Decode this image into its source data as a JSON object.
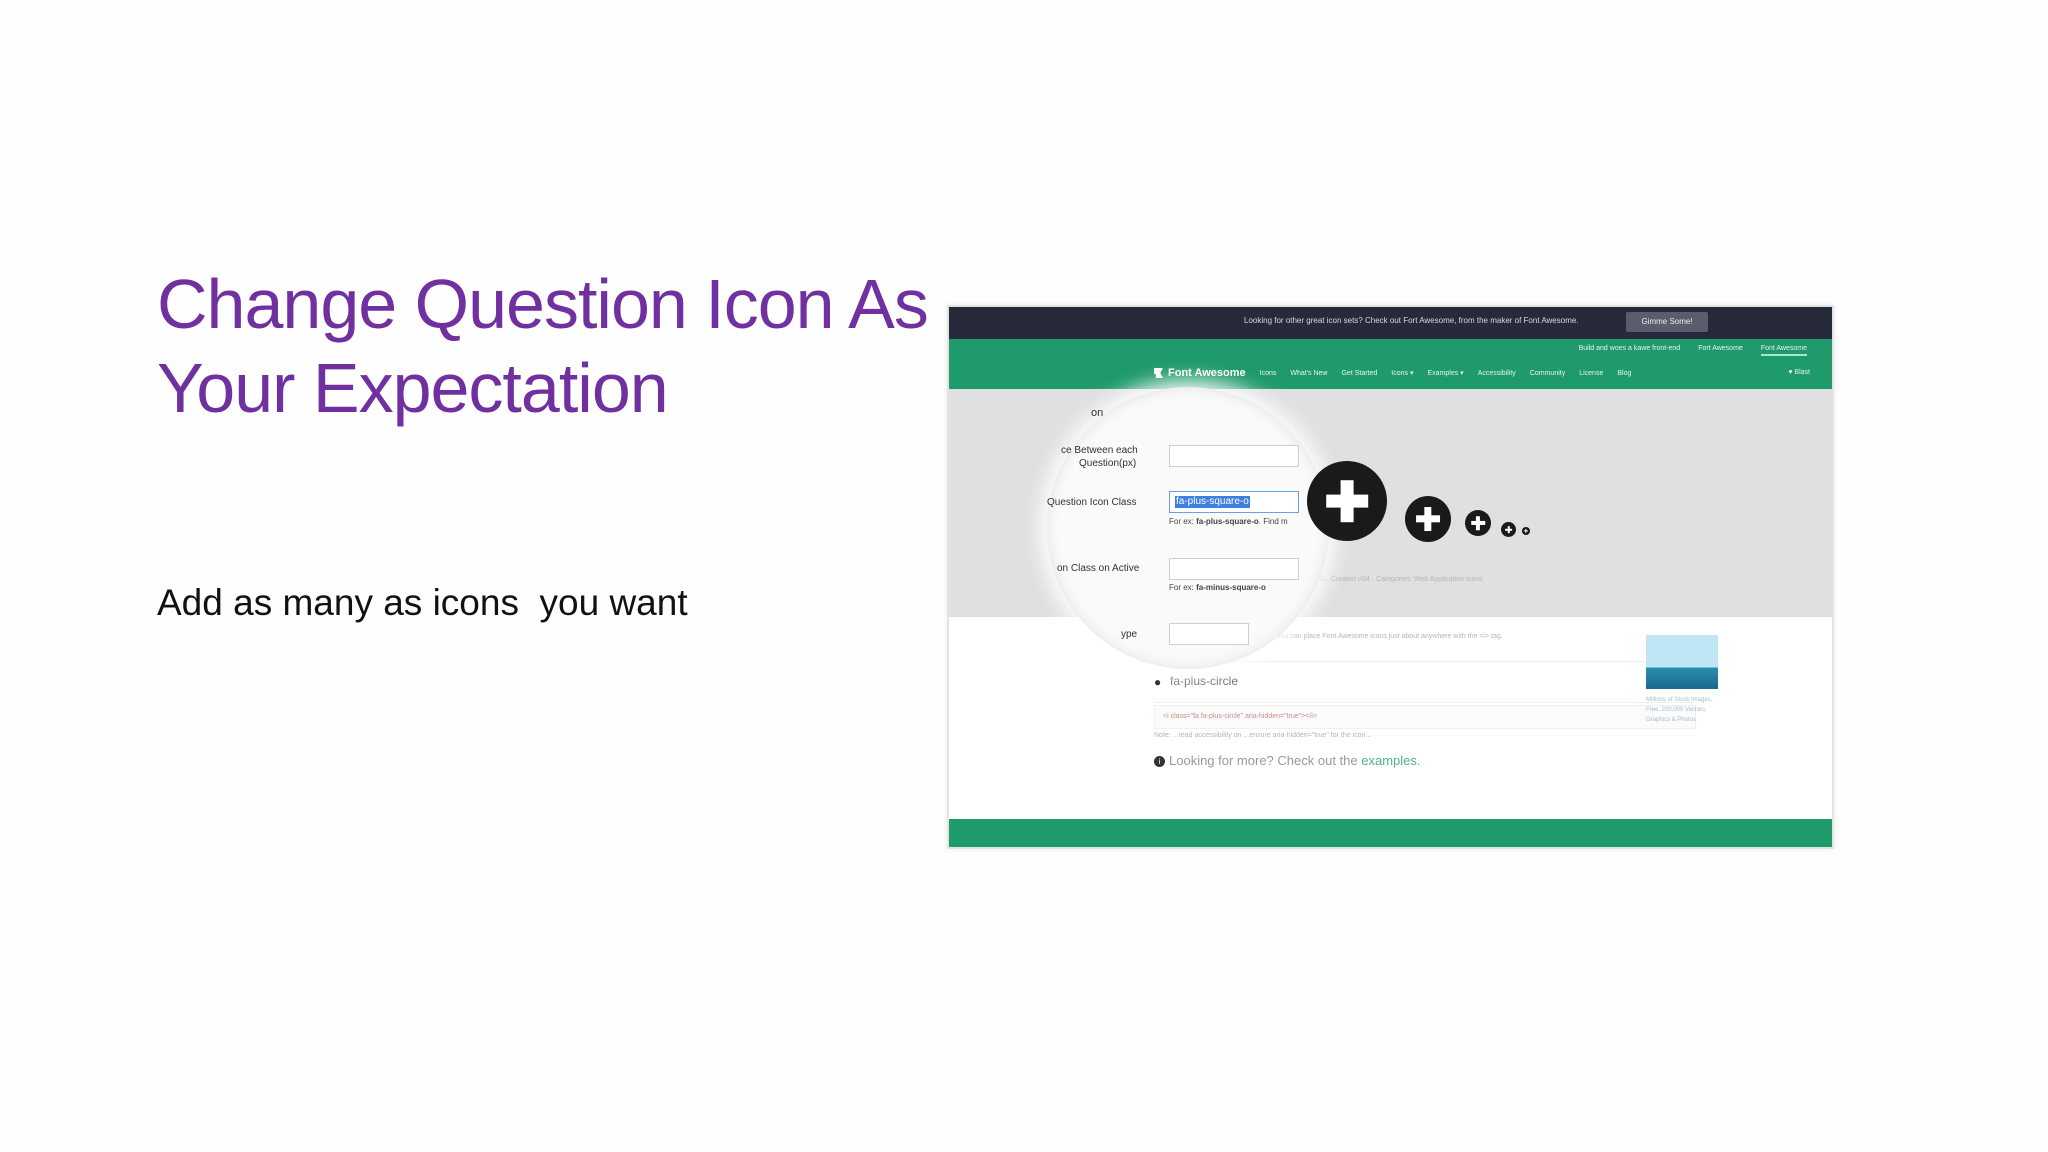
{
  "slide": {
    "title": "Change Question Icon As Your Expectation",
    "body": "Add as many as icons  you want"
  },
  "screenshot": {
    "topbar": {
      "text": "Looking for other great icon sets? Check out Fort Awesome, from the maker of Font Awesome.",
      "button": "Gimme Some!"
    },
    "subnav": [
      "Build and woes a kawe front-end",
      "Fort Awesome",
      "Font Awesome"
    ],
    "brand": "Font Awesome",
    "nav": [
      "Icons",
      "What's New",
      "Get Started",
      "Icons ▾",
      "Examples ▾",
      "Accessibility",
      "Community",
      "License",
      "Blog"
    ],
    "star": "♥ Blast",
    "form": {
      "section_heading": "on",
      "spacing_label_line1": "ce Between each",
      "spacing_label_line2": "Question(px)",
      "icon_class_label": "Question Icon Class",
      "icon_class_value": "fa-plus-square-o",
      "icon_class_hint_prefix": "For ex: ",
      "icon_class_hint_value": "fa-plus-square-o",
      "icon_class_hint_suffix": ". Find m",
      "active_label": "on Class on Active",
      "active_hint_prefix": "For ex: ",
      "active_hint_value": "fa-minus-square-o",
      "type_label": "ype"
    },
    "plus_icon_sizes": [
      "plus-icon-xlarge",
      "plus-icon-large",
      "plus-icon-medium",
      "plus-icon-small",
      "plus-icon-tiny"
    ],
    "faint_line_1": "...ons! SVG · Created vS4 · Categories: Web Application Icons",
    "faint_line_2": "...anywhere you can place Font Awesome icons just about anywhere with the <i> tag.",
    "example_name": "fa-plus-circle",
    "code_snippet": "<i class=\"fa fa-plus-circle\" aria-hidden=\"true\"></i>",
    "faint_line_3": "Note: ...read accessibility on ...ensure aria-hidden=\"true\" for the icon...",
    "more_text": "Looking for more? Check out the ",
    "more_link": "examples.",
    "ad_text": "Millions of Stock Images, Free. 200,000 Vectors, Graphics & Photos"
  }
}
